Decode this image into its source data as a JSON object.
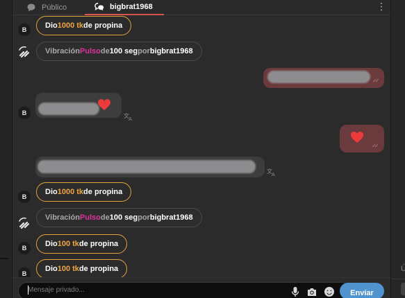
{
  "tabs": {
    "public_label": "Público",
    "private_label": "bigbrat1968"
  },
  "messages": [
    {
      "kind": "tip",
      "avatar": "B",
      "pre": "Dio ",
      "amount": "1000 tk",
      "post": " de propina"
    },
    {
      "kind": "vibration",
      "pre": "Vibración ",
      "pattern": "Pulso",
      "mid": " de ",
      "duration": "100 seg",
      "by": " por ",
      "user": "bigbrat1968"
    },
    {
      "kind": "outgoing-blurred"
    },
    {
      "kind": "incoming-blurred-heart",
      "avatar": "B"
    },
    {
      "kind": "outgoing-heart"
    },
    {
      "kind": "incoming-blurred"
    },
    {
      "kind": "tip",
      "avatar": "B",
      "pre": "Dio ",
      "amount": "1000 tk",
      "post": " de propina"
    },
    {
      "kind": "vibration",
      "pre": "Vibración ",
      "pattern": "Pulso",
      "mid": " de ",
      "duration": "100 seg",
      "by": " por ",
      "user": "bigbrat1968"
    },
    {
      "kind": "tip",
      "avatar": "B",
      "pre": "Dio ",
      "amount": "100 tk",
      "post": " de propina"
    },
    {
      "kind": "tip",
      "avatar": "B",
      "pre": "Dio ",
      "amount": "100 tk",
      "post": " de propina"
    }
  ],
  "input": {
    "placeholder": "Mensaje privado...",
    "send_label": "Enviar"
  },
  "colors": {
    "tip_border": "#e6a23c",
    "tip_amount": "#f0a63c",
    "pulso": "#e0329c",
    "outgoing_bubble": "#6b3a3c",
    "send_button": "#4f93cf",
    "active_tab_underline": "#d9534f"
  }
}
